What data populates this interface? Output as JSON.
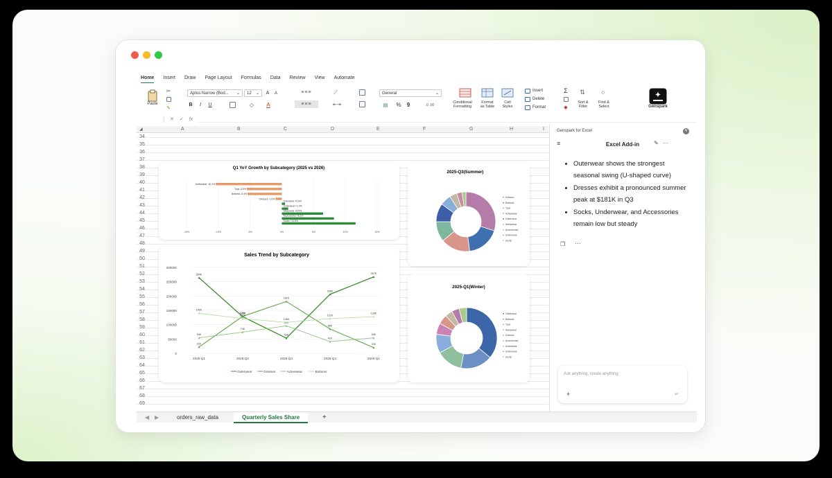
{
  "menu": [
    "Home",
    "Insert",
    "Draw",
    "Page Layout",
    "Formulas",
    "Data",
    "Review",
    "View",
    "Automate"
  ],
  "ribbon": {
    "paste": "Paste",
    "font_name": "Aptos Narrow (Bod...",
    "font_size": "12",
    "bold": "B",
    "italic": "I",
    "underline": "U",
    "number_format": "General",
    "percent": "%",
    "comma": "9",
    "conditional": "Conditional\nFormatting",
    "conditional_l1": "Conditional",
    "conditional_l2": "Formatting",
    "format_table_l1": "Format",
    "format_table_l2": "as Table",
    "cell_styles_l1": "Cell",
    "cell_styles_l2": "Styles",
    "insert": "Insert",
    "delete": "Delete",
    "format": "Format",
    "sort_l1": "Sort &",
    "sort_l2": "Filter",
    "find_l1": "Find &",
    "find_l2": "Select",
    "genspark": "Genspark"
  },
  "formula_bar": {
    "fx": "fx"
  },
  "columns": [
    "A",
    "B",
    "C",
    "D",
    "E",
    "F",
    "G",
    "H",
    "I"
  ],
  "rows": [
    "34",
    "35",
    "36",
    "37",
    "38",
    "39",
    "40",
    "41",
    "42",
    "43",
    "44",
    "45",
    "46",
    "47",
    "48",
    "49",
    "50",
    "51",
    "52",
    "53",
    "54",
    "55",
    "56",
    "57",
    "58",
    "59",
    "60",
    "61",
    "62",
    "63",
    "64",
    "65",
    "66",
    "67",
    "68",
    "69"
  ],
  "sheet_tabs": [
    "orders_raw_data",
    "Quarterly Sales Share"
  ],
  "active_sheet": "Quarterly Sales Share",
  "add_sheet": "+",
  "panel": {
    "app": "Genspark for Excel",
    "title": "Excel Add-in",
    "bullets": [
      "Outerwear shows the strongest seasonal swing (U-shaped curve)",
      "Dresses exhibit a pronounced summer peak at $181K in Q3",
      "Socks, Underwear, and Accessories remain low but steady"
    ],
    "dots": "···",
    "input_placeholder": "Ask anything, create anything",
    "plus": "+"
  },
  "colors": {
    "accent": "#1f7a3d",
    "bar_neg": "#e39a68",
    "bar_pos": "#2e8b3c",
    "line_green": "#4a9d3a"
  },
  "chart_data": [
    {
      "type": "bar",
      "title": "Q1 YoY Growth by Subcategory (2025 vs 2026)",
      "categories": [
        "Activewear",
        "Tops",
        "Bottoms",
        "Dresses",
        "Outerwear",
        "Underwear",
        "Sleepwear",
        "Accessories",
        "Socks"
      ],
      "values": [
        -10.4,
        -5.5,
        -5.4,
        -1.0,
        0.5,
        1.0,
        6.5,
        8.2,
        11.6
      ],
      "labels": [
        "Activewear -10.4%",
        "Tops -5.5%",
        "Bottoms -5.4%",
        "Dresses -1.0%",
        "Outerwear +0.5%",
        "Underwear +1.0%",
        "Sleepwear +6.5%",
        "Accessories +8.2%",
        "Socks +11.6%"
      ],
      "xticks": [
        "-15%",
        "-10%",
        "-5%",
        "0%",
        "5%",
        "10%",
        "15%"
      ],
      "xlim": [
        -15,
        15
      ],
      "grid": true
    },
    {
      "type": "line",
      "title": "Sales Trend by Subcategory",
      "categories": [
        "2025-Q1",
        "2025-Q2",
        "2025-Q3",
        "2025-Q4",
        "2026-Q1"
      ],
      "yticks": [
        "0",
        "50000",
        "100000",
        "150000",
        "200000",
        "250000",
        "300000"
      ],
      "ylim": [
        0,
        300000
      ],
      "series": [
        {
          "name": "Outerwear",
          "values": [
            264000,
            128000,
            53000,
            206000,
            267000
          ],
          "labels": [
            "264K",
            "128K",
            "53K",
            "206K",
            "267K"
          ]
        },
        {
          "name": "Dresses",
          "values": [
            22000,
            129000,
            181000,
            85000,
            20000
          ],
          "labels": [
            "22K",
            "129K",
            "181K",
            "85K",
            "20K"
          ]
        },
        {
          "name": "Activewear",
          "values": [
            54000,
            74000,
            96000,
            41000,
            54000
          ],
          "labels": [
            "54K",
            "74K",
            "96K",
            "41K",
            "54K"
          ]
        },
        {
          "name": "Bottoms",
          "values": [
            140000,
            121000,
            108000,
            121000,
            128000
          ],
          "labels": [
            "140K",
            "121K",
            "108K",
            "121K",
            "128K"
          ]
        }
      ],
      "legend": "bottom"
    },
    {
      "type": "pie",
      "title": "2025-Q3(Summer)",
      "legend_items": [
        "Dresses",
        "Bottoms",
        "Tops",
        "Activewear",
        "Outerwear",
        "Sleepwear",
        "Accessories",
        "Underwear",
        "Socks"
      ],
      "values": [
        30,
        18,
        16,
        11,
        10,
        6,
        4,
        3,
        2
      ],
      "colors": [
        "#b57ca9",
        "#3f6faf",
        "#d8968a",
        "#7db79e",
        "#3e5fa8",
        "#8aaedb",
        "#c2b8a5",
        "#c98d9f",
        "#a9c98f"
      ]
    },
    {
      "type": "pie",
      "title": "2025-Q1(Winter)",
      "legend_items": [
        "Outerwear",
        "Bottoms",
        "Tops",
        "Sleepwear",
        "Dresses",
        "Accessories",
        "Activewear",
        "Underwear",
        "Socks"
      ],
      "values": [
        36,
        17,
        14,
        10,
        6,
        5,
        4,
        4,
        4
      ],
      "colors": [
        "#3b66a8",
        "#6c8fc4",
        "#8fbf9d",
        "#8aaedb",
        "#c984b4",
        "#d8968a",
        "#c2b8a5",
        "#b57ca9",
        "#a9c98f"
      ]
    }
  ]
}
